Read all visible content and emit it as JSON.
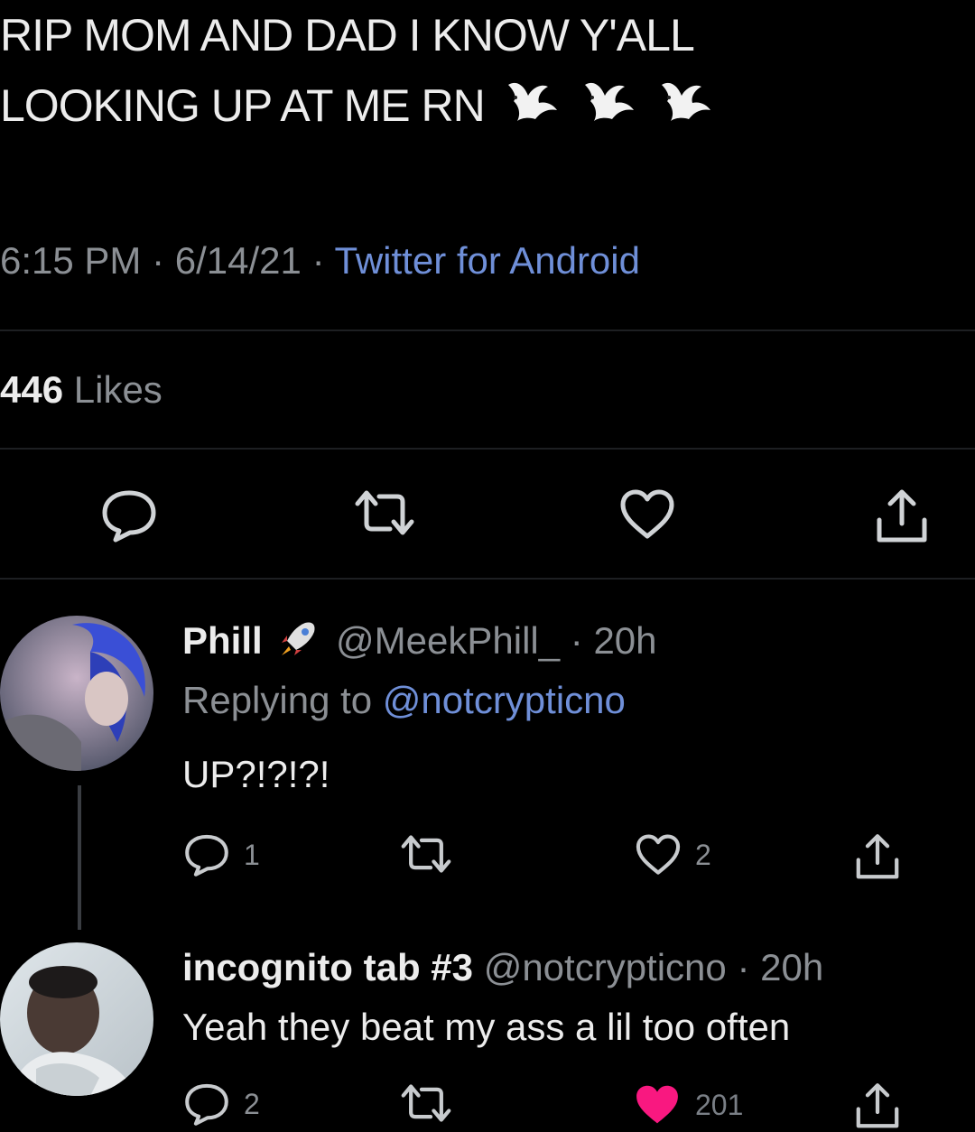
{
  "tweet": {
    "text_line1": "RIP MOM AND DAD I KNOW Y'ALL",
    "text_line2": "LOOKING UP AT ME RN",
    "emoji_icons": [
      "dove-icon",
      "dove-icon",
      "dove-icon"
    ],
    "time": "6:15 PM",
    "date": "6/14/21",
    "separator": "·",
    "source": "Twitter for Android",
    "likes_count": "446",
    "likes_label": "Likes"
  },
  "actions": {
    "reply_icon": "reply-icon",
    "retweet_icon": "retweet-icon",
    "like_icon": "heart-icon",
    "share_icon": "share-icon"
  },
  "replies": [
    {
      "name": "Phill",
      "name_emoji": "rocket-icon",
      "handle": "@MeekPhill_",
      "time": "20h",
      "replying_prefix": "Replying to",
      "replying_to": "@notcrypticno",
      "text": "UP?!?!?!",
      "reply_count": "1",
      "retweet_count": "",
      "like_count": "2",
      "liked": false
    },
    {
      "name": "incognito tab #3",
      "handle": "@notcrypticno",
      "time": "20h",
      "text": "Yeah they beat my ass a lil too often",
      "reply_count": "2",
      "retweet_count": "",
      "like_count": "201",
      "liked": true
    }
  ],
  "colors": {
    "background": "#000000",
    "text": "#ececec",
    "muted": "#8b8f94",
    "link": "#6f8fd8",
    "liked": "#f91880"
  }
}
